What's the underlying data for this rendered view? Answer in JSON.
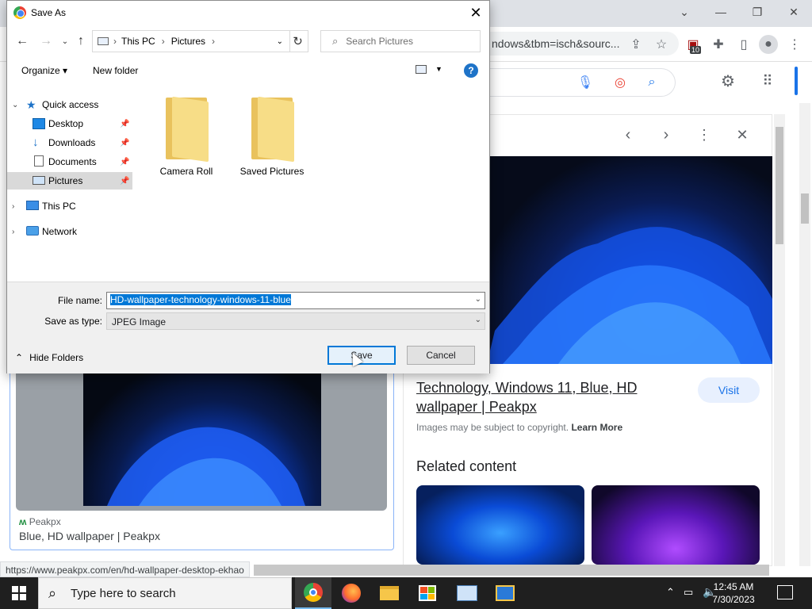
{
  "dialog": {
    "title": "Save As",
    "breadcrumb": [
      "This PC",
      "Pictures"
    ],
    "search_placeholder": "Search Pictures",
    "organize_label": "Organize ▾",
    "new_folder_label": "New folder",
    "tree": [
      {
        "label": "Quick access",
        "icon": "star-icon",
        "level": 0,
        "expanded": true
      },
      {
        "label": "Desktop",
        "icon": "desktop-icon",
        "level": 1,
        "pinned": true
      },
      {
        "label": "Downloads",
        "icon": "download-arrow-icon",
        "level": 1,
        "pinned": true
      },
      {
        "label": "Documents",
        "icon": "document-icon",
        "level": 1,
        "pinned": true
      },
      {
        "label": "Pictures",
        "icon": "pictures-icon",
        "level": 1,
        "pinned": true,
        "selected": true
      },
      {
        "label": "This PC",
        "icon": "computer-icon",
        "level": 0,
        "expanded": false
      },
      {
        "label": "Network",
        "icon": "network-icon",
        "level": 0,
        "expanded": false
      }
    ],
    "folders": [
      "Camera Roll",
      "Saved Pictures"
    ],
    "filename_label": "File name:",
    "filename_value": "HD-wallpaper-technology-windows-11-blue",
    "savetype_label": "Save as type:",
    "savetype_value": "JPEG Image",
    "hide_folders_label": "Hide Folders",
    "save_label": "Save",
    "cancel_label": "Cancel"
  },
  "browser": {
    "omnibox_text": "ndows&tbm=isch&sourc...",
    "extension_badge": "10",
    "preview_title": "Technology, Windows 11, Blue, HD wallpaper | Peakpx",
    "visit_label": "Visit",
    "copyright_text": "Images may be subject to copyright.",
    "learn_more_label": "Learn More",
    "related_heading": "Related content",
    "result_source": "Peakpx",
    "result_title": "Blue, HD wallpaper | Peakpx",
    "status_url": "https://www.peakpx.com/en/hd-wallpaper-desktop-ekhao"
  },
  "taskbar": {
    "search_placeholder": "Type here to search",
    "time": "12:45 AM",
    "date": "7/30/2023"
  },
  "colors": {
    "accent": "#0078d7",
    "chrome_blue": "#1a73e8"
  }
}
